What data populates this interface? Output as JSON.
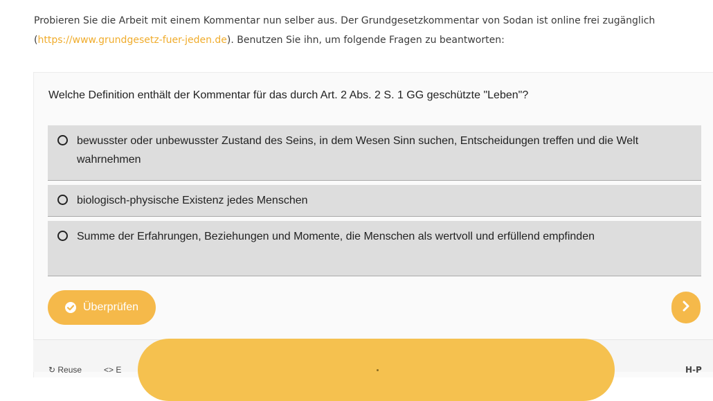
{
  "intro": {
    "text_before_link": "Probieren Sie die Arbeit mit einem Kommentar nun selber aus. Der Grundgesetzkommentar von Sodan ist online frei zugänglich (",
    "link_text": "https://www.grundgesetz-fuer-jeden.de",
    "text_after_link": "). Benutzen Sie ihn, um folgende Fragen zu beantworten:"
  },
  "quiz": {
    "question": "Welche Definition enthält der Kommentar für das durch Art. 2 Abs. 2 S. 1 GG geschützte \"Leben\"?",
    "options": [
      {
        "label": "bewusster oder unbewusster Zustand des Seins, in dem Wesen Sinn suchen, Entscheidungen treffen und die Welt wahrnehmen"
      },
      {
        "label": "biologisch-physische Existenz jedes Menschen"
      },
      {
        "label": "Summe der Erfahrungen, Beziehungen und Momente, die Menschen als wertvoll und erfüllend empfinden"
      }
    ],
    "check_button_label": "Überprüfen",
    "check_icon": "check-circle-icon",
    "next_icon": "chevron-right-icon"
  },
  "footer": {
    "reuse_label": "Reuse",
    "embed_label": "<> E",
    "brand": "H-P"
  },
  "colors": {
    "accent": "#f5b94a",
    "link": "#f0ac2c",
    "option_bg": "#dddddd"
  }
}
